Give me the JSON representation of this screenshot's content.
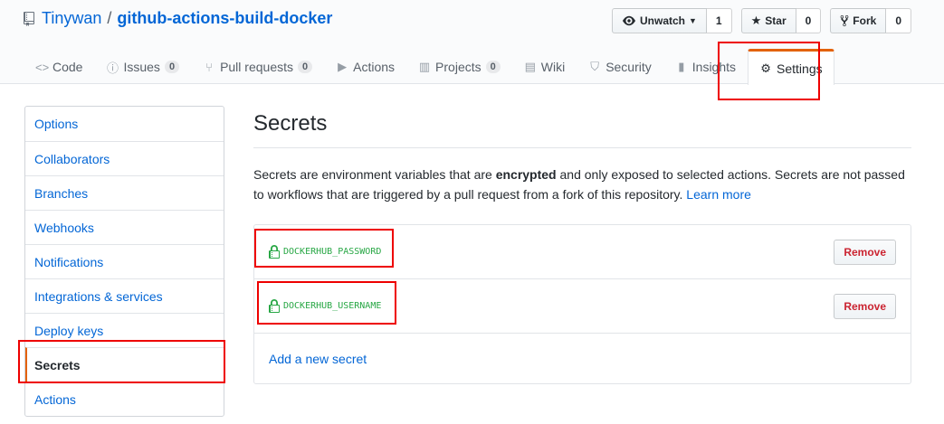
{
  "repo": {
    "owner": "Tinywan",
    "separator": "/",
    "name": "github-actions-build-docker"
  },
  "actions": {
    "watch": {
      "label": "Unwatch",
      "count": "1"
    },
    "star": {
      "label": "Star",
      "count": "0"
    },
    "fork": {
      "label": "Fork",
      "count": "0"
    }
  },
  "tabs": [
    {
      "label": "Code",
      "icon": "code-icon"
    },
    {
      "label": "Issues",
      "icon": "issue-icon",
      "counter": "0"
    },
    {
      "label": "Pull requests",
      "icon": "pull-request-icon",
      "counter": "0"
    },
    {
      "label": "Actions",
      "icon": "play-icon"
    },
    {
      "label": "Projects",
      "icon": "project-icon",
      "counter": "0"
    },
    {
      "label": "Wiki",
      "icon": "book-icon"
    },
    {
      "label": "Security",
      "icon": "shield-icon"
    },
    {
      "label": "Insights",
      "icon": "graph-icon"
    },
    {
      "label": "Settings",
      "icon": "gear-icon",
      "selected": true
    }
  ],
  "sidebar": {
    "items": [
      {
        "label": "Options"
      },
      {
        "label": "Collaborators"
      },
      {
        "label": "Branches"
      },
      {
        "label": "Webhooks"
      },
      {
        "label": "Notifications"
      },
      {
        "label": "Integrations & services"
      },
      {
        "label": "Deploy keys"
      },
      {
        "label": "Secrets",
        "selected": true
      },
      {
        "label": "Actions"
      }
    ]
  },
  "main": {
    "title": "Secrets",
    "desc_pre": "Secrets are environment variables that are ",
    "desc_bold": "encrypted",
    "desc_post": " and only exposed to selected actions. Secrets are not passed to workflows that are triggered by a pull request from a fork of this repository. ",
    "learn_more": "Learn more",
    "secrets": [
      {
        "name": "DOCKERHUB_PASSWORD",
        "remove_label": "Remove"
      },
      {
        "name": "DOCKERHUB_USERNAME",
        "remove_label": "Remove"
      }
    ],
    "add_secret": "Add a new secret"
  },
  "colors": {
    "accent": "#e36209",
    "link": "#0366d6",
    "success": "#28a745",
    "danger": "#cb2431",
    "highlight": "#e00000"
  }
}
